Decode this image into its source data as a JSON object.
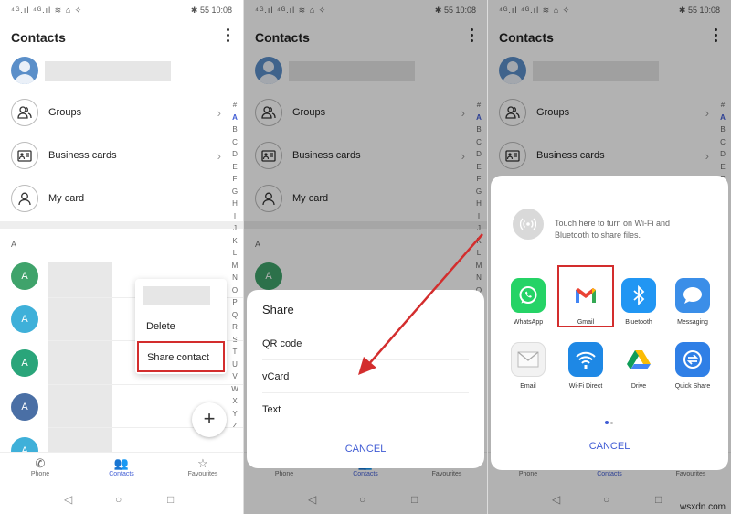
{
  "status": {
    "left": "⁴ᴳ.ıl ⁴ᴳ.ıl ≋ ⌂ ✧",
    "right_bt": "✱",
    "right_battery": "55",
    "time": "10:08"
  },
  "header": {
    "title": "Contacts"
  },
  "contacts_list": [
    {
      "label": "Groups",
      "icon": "groups-icon"
    },
    {
      "label": "Business cards",
      "icon": "business-card-icon"
    },
    {
      "label": "My card",
      "icon": "person-icon"
    }
  ],
  "section_letter": "A",
  "alphabet": [
    "#",
    "A",
    "B",
    "C",
    "D",
    "E",
    "F",
    "G",
    "H",
    "I",
    "J",
    "K",
    "L",
    "M",
    "N",
    "O",
    "P",
    "Q",
    "R",
    "S",
    "T",
    "U",
    "V",
    "W",
    "X",
    "Y",
    "Z"
  ],
  "contact_avatars": [
    {
      "letter": "A",
      "color": "#3fa36b"
    },
    {
      "letter": "A",
      "color": "#3fb0d9"
    },
    {
      "letter": "A",
      "color": "#2aa57a"
    },
    {
      "letter": "A",
      "color": "#4a6fa5"
    },
    {
      "letter": "A",
      "color": "#3fb0d9"
    }
  ],
  "popup_menu": {
    "delete": "Delete",
    "share": "Share contact"
  },
  "fab": {
    "label": "+"
  },
  "bottom_nav": [
    {
      "label": "Phone",
      "icon": "phone-icon"
    },
    {
      "label": "Contacts",
      "icon": "contacts-icon"
    },
    {
      "label": "Favourites",
      "icon": "star-icon"
    }
  ],
  "system_nav": {
    "back": "◁",
    "home": "○",
    "recent": "□"
  },
  "share_sheet": {
    "title": "Share",
    "options": [
      "QR code",
      "vCard",
      "Text"
    ],
    "cancel": "CANCEL"
  },
  "share_apps": {
    "wifi_hint": "Touch here to turn on Wi-Fi and Bluetooth to share files.",
    "apps": [
      {
        "name": "WhatsApp",
        "color": "#25d366",
        "icon": "whatsapp-icon"
      },
      {
        "name": "Gmail",
        "color": "#ffffff",
        "icon": "gmail-icon"
      },
      {
        "name": "Bluetooth",
        "color": "#2196f3",
        "icon": "bluetooth-icon"
      },
      {
        "name": "Messaging",
        "color": "#3b8ee8",
        "icon": "messaging-icon"
      },
      {
        "name": "Email",
        "color": "#f2f2f2",
        "icon": "email-icon"
      },
      {
        "name": "Wi-Fi Direct",
        "color": "#1e88e5",
        "icon": "wifi-direct-icon"
      },
      {
        "name": "Drive",
        "color": "#ffffff",
        "icon": "drive-icon"
      },
      {
        "name": "Quick Share",
        "color": "#2f7fe6",
        "icon": "quick-share-icon"
      }
    ],
    "cancel": "CANCEL"
  },
  "colors": {
    "accent": "#3f5bd4",
    "highlight": "#d32d2d"
  },
  "watermark": "wsxdn.com"
}
